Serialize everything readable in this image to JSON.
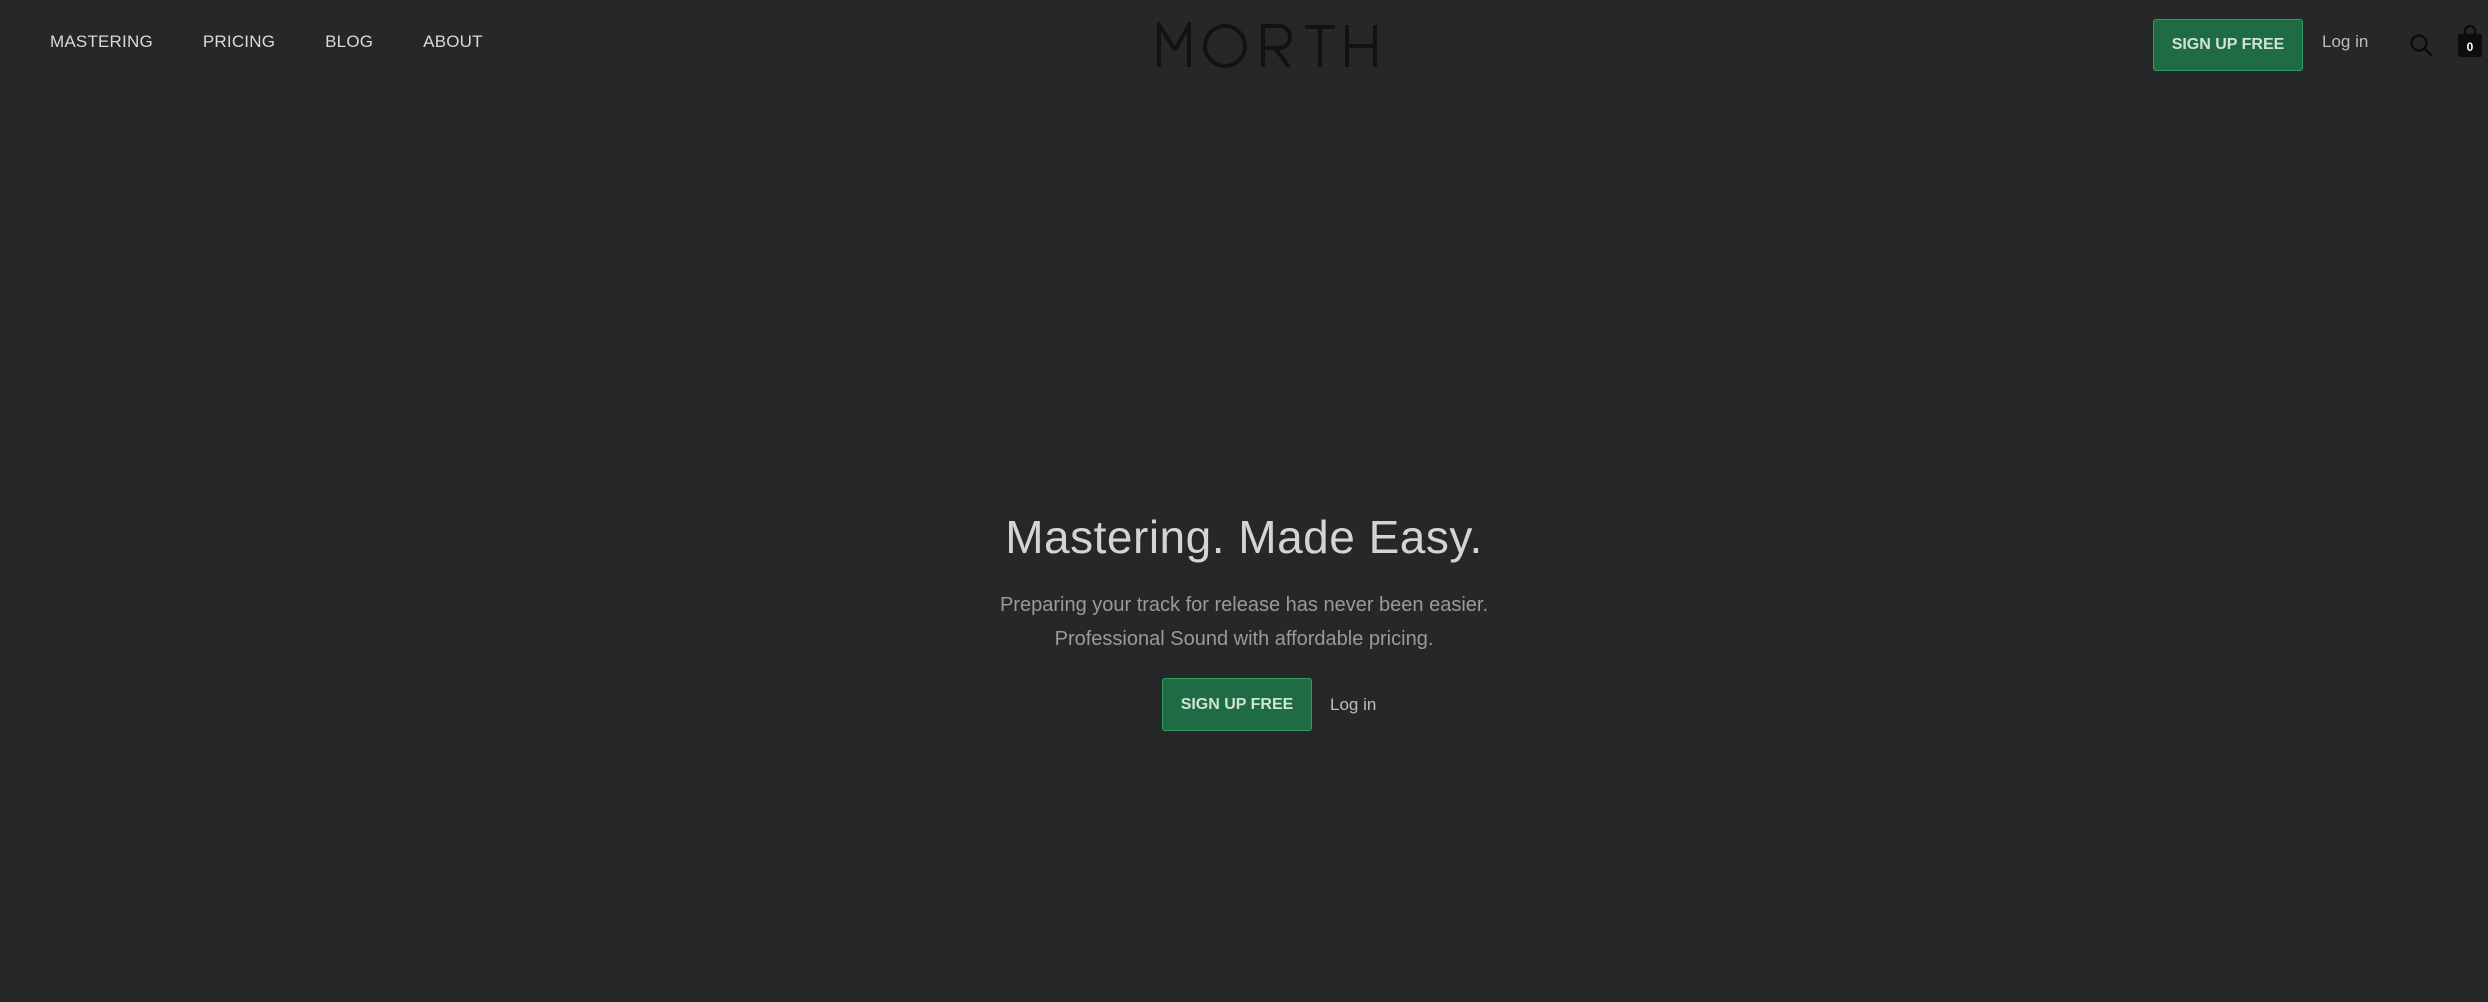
{
  "nav": {
    "items": [
      {
        "label": "MASTERING"
      },
      {
        "label": "PRICING"
      },
      {
        "label": "BLOG"
      },
      {
        "label": "ABOUT"
      }
    ]
  },
  "brand": {
    "logo_text": "MORTH"
  },
  "header": {
    "signup_label": "SIGN UP FREE",
    "login_label": "Log in",
    "cart_count": "0"
  },
  "hero": {
    "title": "Mastering. Made Easy.",
    "subtitle_line1": "Preparing your track for release has never been easier.",
    "subtitle_line2": "Professional Sound with affordable pricing.",
    "signup_label": "SIGN UP FREE",
    "login_label": "Log in"
  },
  "colors": {
    "background": "#262729",
    "accent_green": "#1f6b44",
    "accent_green_border": "#2f9a62",
    "logo": "#111214"
  },
  "icons": {
    "search": "search-icon",
    "cart": "shopping-bag-icon"
  }
}
